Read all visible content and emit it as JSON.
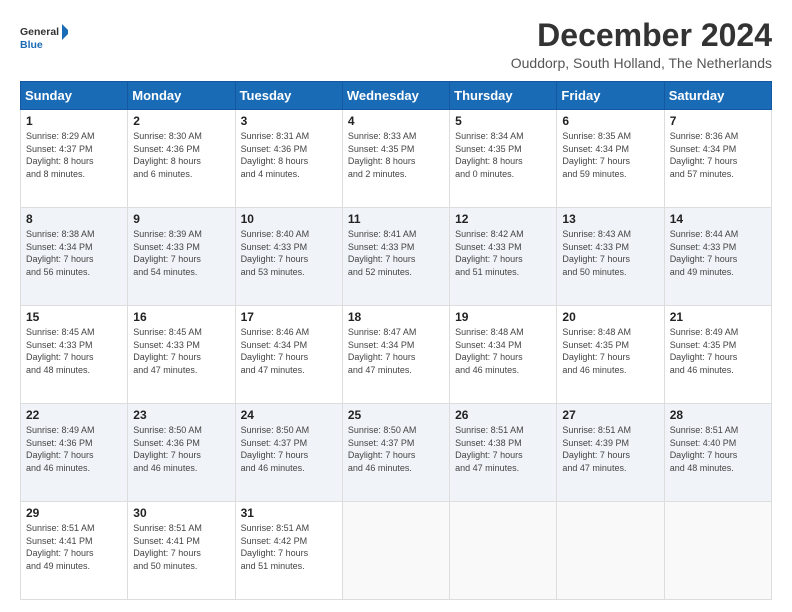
{
  "header": {
    "logo_line1": "General",
    "logo_line2": "Blue",
    "title": "December 2024",
    "subtitle": "Ouddorp, South Holland, The Netherlands"
  },
  "days_of_week": [
    "Sunday",
    "Monday",
    "Tuesday",
    "Wednesday",
    "Thursday",
    "Friday",
    "Saturday"
  ],
  "weeks": [
    [
      {
        "day": "1",
        "sunrise": "8:29 AM",
        "sunset": "4:37 PM",
        "daylight": "8 hours and 8 minutes."
      },
      {
        "day": "2",
        "sunrise": "8:30 AM",
        "sunset": "4:36 PM",
        "daylight": "8 hours and 6 minutes."
      },
      {
        "day": "3",
        "sunrise": "8:31 AM",
        "sunset": "4:36 PM",
        "daylight": "8 hours and 4 minutes."
      },
      {
        "day": "4",
        "sunrise": "8:33 AM",
        "sunset": "4:35 PM",
        "daylight": "8 hours and 2 minutes."
      },
      {
        "day": "5",
        "sunrise": "8:34 AM",
        "sunset": "4:35 PM",
        "daylight": "8 hours and 0 minutes."
      },
      {
        "day": "6",
        "sunrise": "8:35 AM",
        "sunset": "4:34 PM",
        "daylight": "7 hours and 59 minutes."
      },
      {
        "day": "7",
        "sunrise": "8:36 AM",
        "sunset": "4:34 PM",
        "daylight": "7 hours and 57 minutes."
      }
    ],
    [
      {
        "day": "8",
        "sunrise": "8:38 AM",
        "sunset": "4:34 PM",
        "daylight": "7 hours and 56 minutes."
      },
      {
        "day": "9",
        "sunrise": "8:39 AM",
        "sunset": "4:33 PM",
        "daylight": "7 hours and 54 minutes."
      },
      {
        "day": "10",
        "sunrise": "8:40 AM",
        "sunset": "4:33 PM",
        "daylight": "7 hours and 53 minutes."
      },
      {
        "day": "11",
        "sunrise": "8:41 AM",
        "sunset": "4:33 PM",
        "daylight": "7 hours and 52 minutes."
      },
      {
        "day": "12",
        "sunrise": "8:42 AM",
        "sunset": "4:33 PM",
        "daylight": "7 hours and 51 minutes."
      },
      {
        "day": "13",
        "sunrise": "8:43 AM",
        "sunset": "4:33 PM",
        "daylight": "7 hours and 50 minutes."
      },
      {
        "day": "14",
        "sunrise": "8:44 AM",
        "sunset": "4:33 PM",
        "daylight": "7 hours and 49 minutes."
      }
    ],
    [
      {
        "day": "15",
        "sunrise": "8:45 AM",
        "sunset": "4:33 PM",
        "daylight": "7 hours and 48 minutes."
      },
      {
        "day": "16",
        "sunrise": "8:45 AM",
        "sunset": "4:33 PM",
        "daylight": "7 hours and 47 minutes."
      },
      {
        "day": "17",
        "sunrise": "8:46 AM",
        "sunset": "4:34 PM",
        "daylight": "7 hours and 47 minutes."
      },
      {
        "day": "18",
        "sunrise": "8:47 AM",
        "sunset": "4:34 PM",
        "daylight": "7 hours and 47 minutes."
      },
      {
        "day": "19",
        "sunrise": "8:48 AM",
        "sunset": "4:34 PM",
        "daylight": "7 hours and 46 minutes."
      },
      {
        "day": "20",
        "sunrise": "8:48 AM",
        "sunset": "4:35 PM",
        "daylight": "7 hours and 46 minutes."
      },
      {
        "day": "21",
        "sunrise": "8:49 AM",
        "sunset": "4:35 PM",
        "daylight": "7 hours and 46 minutes."
      }
    ],
    [
      {
        "day": "22",
        "sunrise": "8:49 AM",
        "sunset": "4:36 PM",
        "daylight": "7 hours and 46 minutes."
      },
      {
        "day": "23",
        "sunrise": "8:50 AM",
        "sunset": "4:36 PM",
        "daylight": "7 hours and 46 minutes."
      },
      {
        "day": "24",
        "sunrise": "8:50 AM",
        "sunset": "4:37 PM",
        "daylight": "7 hours and 46 minutes."
      },
      {
        "day": "25",
        "sunrise": "8:50 AM",
        "sunset": "4:37 PM",
        "daylight": "7 hours and 46 minutes."
      },
      {
        "day": "26",
        "sunrise": "8:51 AM",
        "sunset": "4:38 PM",
        "daylight": "7 hours and 47 minutes."
      },
      {
        "day": "27",
        "sunrise": "8:51 AM",
        "sunset": "4:39 PM",
        "daylight": "7 hours and 47 minutes."
      },
      {
        "day": "28",
        "sunrise": "8:51 AM",
        "sunset": "4:40 PM",
        "daylight": "7 hours and 48 minutes."
      }
    ],
    [
      {
        "day": "29",
        "sunrise": "8:51 AM",
        "sunset": "4:41 PM",
        "daylight": "7 hours and 49 minutes."
      },
      {
        "day": "30",
        "sunrise": "8:51 AM",
        "sunset": "4:41 PM",
        "daylight": "7 hours and 50 minutes."
      },
      {
        "day": "31",
        "sunrise": "8:51 AM",
        "sunset": "4:42 PM",
        "daylight": "7 hours and 51 minutes."
      },
      null,
      null,
      null,
      null
    ]
  ]
}
